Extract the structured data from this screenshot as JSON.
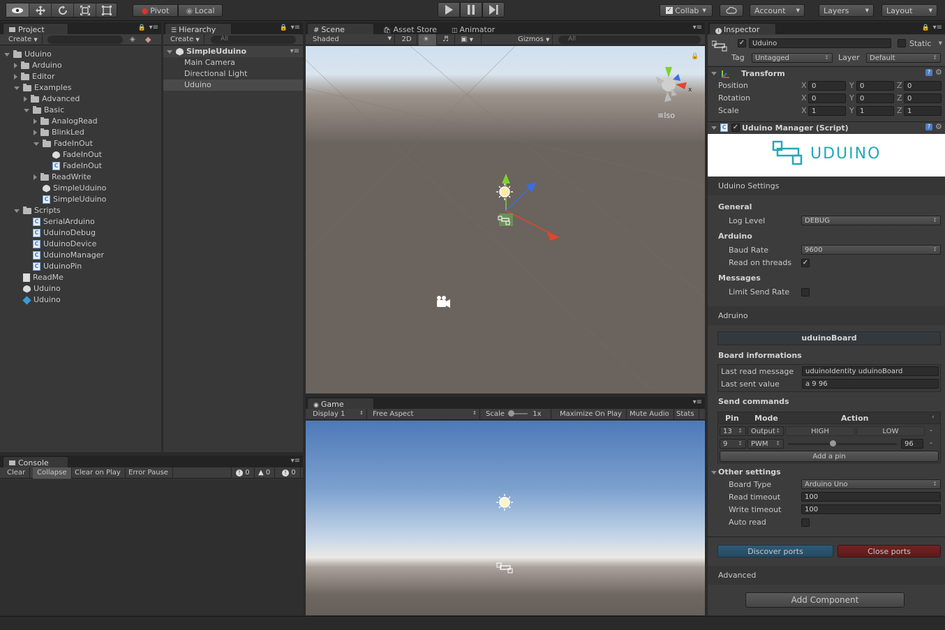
{
  "toolbar": {
    "pivot": "Pivot",
    "local": "Local",
    "collab": "Collab",
    "account": "Account",
    "layers": "Layers",
    "layout": "Layout"
  },
  "project": {
    "tab": "Project",
    "create": "Create",
    "tree": [
      {
        "label": "Uduino",
        "type": "folder",
        "open": true
      },
      {
        "label": "Arduino",
        "type": "folder",
        "open": false
      },
      {
        "label": "Editor",
        "type": "folder",
        "open": false
      },
      {
        "label": "Examples",
        "type": "folder",
        "open": true
      },
      {
        "label": "Advanced",
        "type": "folder",
        "open": false
      },
      {
        "label": "Basic",
        "type": "folder",
        "open": true
      },
      {
        "label": "AnalogRead",
        "type": "folder",
        "open": false
      },
      {
        "label": "BlinkLed",
        "type": "folder",
        "open": false
      },
      {
        "label": "FadeInOut",
        "type": "folder",
        "open": true
      },
      {
        "label": "FadeInOut",
        "type": "scene"
      },
      {
        "label": "FadeInOut",
        "type": "script"
      },
      {
        "label": "ReadWrite",
        "type": "folder",
        "open": false
      },
      {
        "label": "SimpleUduino",
        "type": "scene"
      },
      {
        "label": "SimpleUduino",
        "type": "script"
      },
      {
        "label": "Scripts",
        "type": "folder",
        "open": true
      },
      {
        "label": "SerialArduino",
        "type": "script"
      },
      {
        "label": "UduinoDebug",
        "type": "script"
      },
      {
        "label": "UduinoDevice",
        "type": "script"
      },
      {
        "label": "UduinoManager",
        "type": "script"
      },
      {
        "label": "UduinoPin",
        "type": "script"
      },
      {
        "label": "ReadMe",
        "type": "text"
      },
      {
        "label": "Uduino",
        "type": "scene"
      },
      {
        "label": "Uduino",
        "type": "prefab"
      }
    ]
  },
  "hierarchy": {
    "tab": "Hierarchy",
    "create": "Create",
    "search": "All",
    "scene": "SimpleUduino",
    "items": [
      "Main Camera",
      "Directional Light",
      "Uduino"
    ]
  },
  "console": {
    "tab": "Console",
    "buttons": [
      "Clear",
      "Collapse",
      "Clear on Play",
      "Error Pause"
    ],
    "counts": {
      "info": "0",
      "warn": "0",
      "error": "0"
    }
  },
  "scene": {
    "tabs": [
      "Scene",
      "Asset Store",
      "Animator"
    ],
    "shaded": "Shaded",
    "mode2d": "2D",
    "gizmos": "Gizmos",
    "search": "All",
    "iso": "Iso"
  },
  "game": {
    "tab": "Game",
    "display": "Display 1",
    "aspect": "Free Aspect",
    "scale_label": "Scale",
    "scale_value": "1x",
    "buttons": [
      "Maximize On Play",
      "Mute Audio",
      "Stats"
    ]
  },
  "inspector": {
    "tab": "Inspector",
    "object_name": "Uduino",
    "static_label": "Static",
    "tag_label": "Tag",
    "tag_value": "Untagged",
    "layer_label": "Layer",
    "layer_value": "Default",
    "transform": {
      "title": "Transform",
      "rows": [
        {
          "label": "Position",
          "x": "0",
          "y": "0",
          "z": "0"
        },
        {
          "label": "Rotation",
          "x": "0",
          "y": "0",
          "z": "0"
        },
        {
          "label": "Scale",
          "x": "1",
          "y": "1",
          "z": "1"
        }
      ]
    },
    "manager": {
      "title": "Uduino Manager (Script)",
      "logo": "UDUINO",
      "settings_header": "Uduino Settings",
      "general": "General",
      "log_level_label": "Log Level",
      "log_level_value": "DEBUG",
      "arduino": "Arduino",
      "baud_label": "Baud Rate",
      "baud_value": "9600",
      "threads_label": "Read on threads",
      "messages": "Messages",
      "limit_label": "Limit Send Rate",
      "adruino_header": "Adruino",
      "board_name": "uduinoBoard",
      "board_info": "Board informations",
      "last_read_label": "Last read message",
      "last_read_value": "uduinoIdentity uduinoBoard",
      "last_sent_label": "Last sent value",
      "last_sent_value": "a 9 96",
      "send_commands": "Send commands",
      "cmd_headers": [
        "Pin",
        "Mode",
        "Action"
      ],
      "cmd_rows": [
        {
          "pin": "13",
          "mode": "Output",
          "high": "HIGH",
          "low": "LOW"
        },
        {
          "pin": "9",
          "mode": "PWM",
          "value": "96",
          "pwm_fraction": 0.41
        }
      ],
      "add_pin": "Add a pin",
      "other_settings": "Other settings",
      "board_type_label": "Board Type",
      "board_type_value": "Arduino Uno",
      "read_timeout_label": "Read timeout",
      "read_timeout_value": "100",
      "write_timeout_label": "Write timeout",
      "write_timeout_value": "100",
      "auto_read_label": "Auto read",
      "discover": "Discover ports",
      "close": "Close ports",
      "advanced": "Advanced"
    },
    "add_component": "Add Component"
  }
}
